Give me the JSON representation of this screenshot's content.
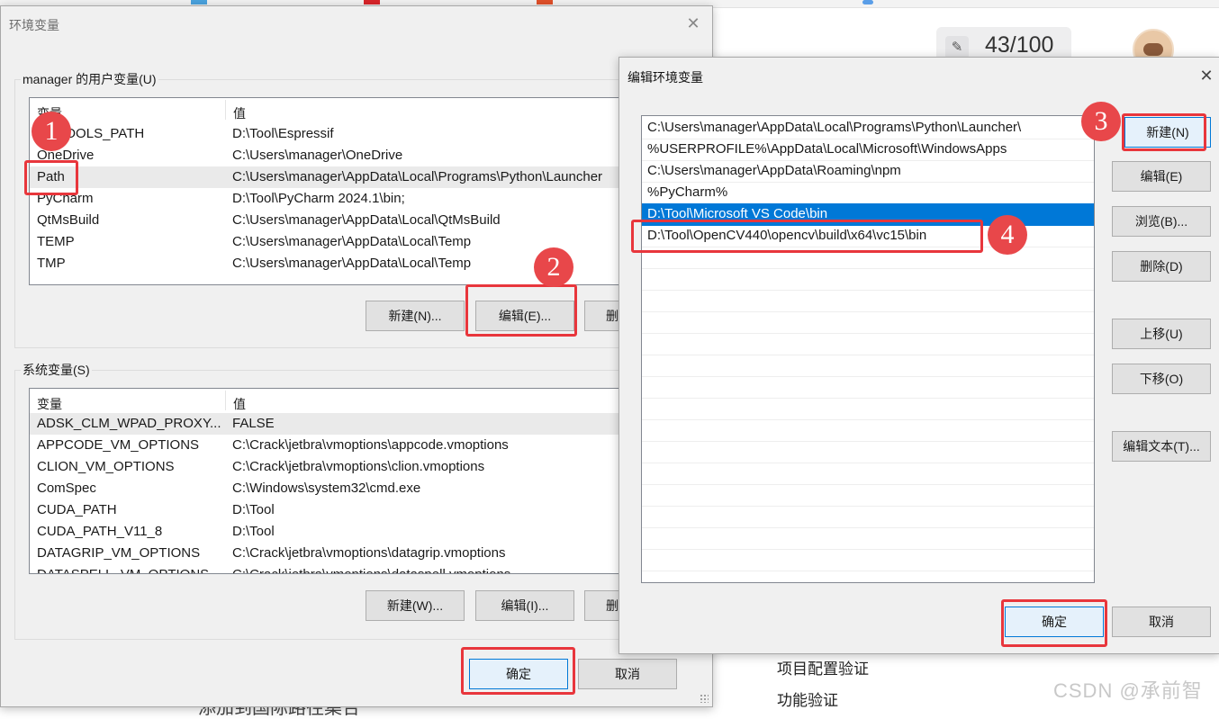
{
  "background": {
    "counter": "43/100",
    "nav_items": [
      "项目配置验证",
      "功能验证"
    ],
    "bottom_text": "添加到国际路径集合",
    "watermark": "CSDN @承前智"
  },
  "env_window": {
    "title": "环境变量",
    "user_group_label": "manager 的用户变量(U)",
    "col_name": "变量",
    "col_value": "值",
    "user_vars": [
      {
        "name": "EMTOOLS_PATH",
        "value": "D:\\Tool\\Espressif"
      },
      {
        "name": "OneDrive",
        "value": "C:\\Users\\manager\\OneDrive"
      },
      {
        "name": "Path",
        "value": "C:\\Users\\manager\\AppData\\Local\\Programs\\Python\\Launcher"
      },
      {
        "name": "PyCharm",
        "value": "D:\\Tool\\PyCharm 2024.1\\bin;"
      },
      {
        "name": "QtMsBuild",
        "value": "C:\\Users\\manager\\AppData\\Local\\QtMsBuild"
      },
      {
        "name": "TEMP",
        "value": "C:\\Users\\manager\\AppData\\Local\\Temp"
      },
      {
        "name": "TMP",
        "value": "C:\\Users\\manager\\AppData\\Local\\Temp"
      }
    ],
    "user_buttons": {
      "new": "新建(N)...",
      "edit": "编辑(E)...",
      "delete": "删"
    },
    "system_group_label": "系统变量(S)",
    "system_vars": [
      {
        "name": "ADSK_CLM_WPAD_PROXY...",
        "value": "FALSE"
      },
      {
        "name": "APPCODE_VM_OPTIONS",
        "value": "C:\\Crack\\jetbra\\vmoptions\\appcode.vmoptions"
      },
      {
        "name": "CLION_VM_OPTIONS",
        "value": "C:\\Crack\\jetbra\\vmoptions\\clion.vmoptions"
      },
      {
        "name": "ComSpec",
        "value": "C:\\Windows\\system32\\cmd.exe"
      },
      {
        "name": "CUDA_PATH",
        "value": "D:\\Tool"
      },
      {
        "name": "CUDA_PATH_V11_8",
        "value": "D:\\Tool"
      },
      {
        "name": "DATAGRIP_VM_OPTIONS",
        "value": "C:\\Crack\\jetbra\\vmoptions\\datagrip.vmoptions"
      },
      {
        "name": "DATASPELL_VM_OPTIONS",
        "value": "C:\\Crack\\jetbra\\vmoptions\\dataspell.vmoptions"
      }
    ],
    "system_buttons": {
      "new": "新建(W)...",
      "edit": "编辑(I)...",
      "delete": "删"
    },
    "ok": "确定",
    "cancel": "取消"
  },
  "edit_window": {
    "title": "编辑环境变量",
    "paths": [
      "C:\\Users\\manager\\AppData\\Local\\Programs\\Python\\Launcher\\",
      "%USERPROFILE%\\AppData\\Local\\Microsoft\\WindowsApps",
      "C:\\Users\\manager\\AppData\\Roaming\\npm",
      "%PyCharm%",
      "D:\\Tool\\Microsoft VS Code\\bin",
      "D:\\Tool\\OpenCV440\\opencv\\build\\x64\\vc15\\bin"
    ],
    "selected_index": 4,
    "buttons": {
      "new": "新建(N)",
      "edit": "编辑(E)",
      "browse": "浏览(B)...",
      "delete": "删除(D)",
      "up": "上移(U)",
      "down": "下移(O)",
      "edit_text": "编辑文本(T)..."
    },
    "ok": "确定",
    "cancel": "取消"
  },
  "annotations": {
    "badges": [
      "1",
      "2",
      "3",
      "4"
    ],
    "highlight_color": "#e8363c"
  }
}
